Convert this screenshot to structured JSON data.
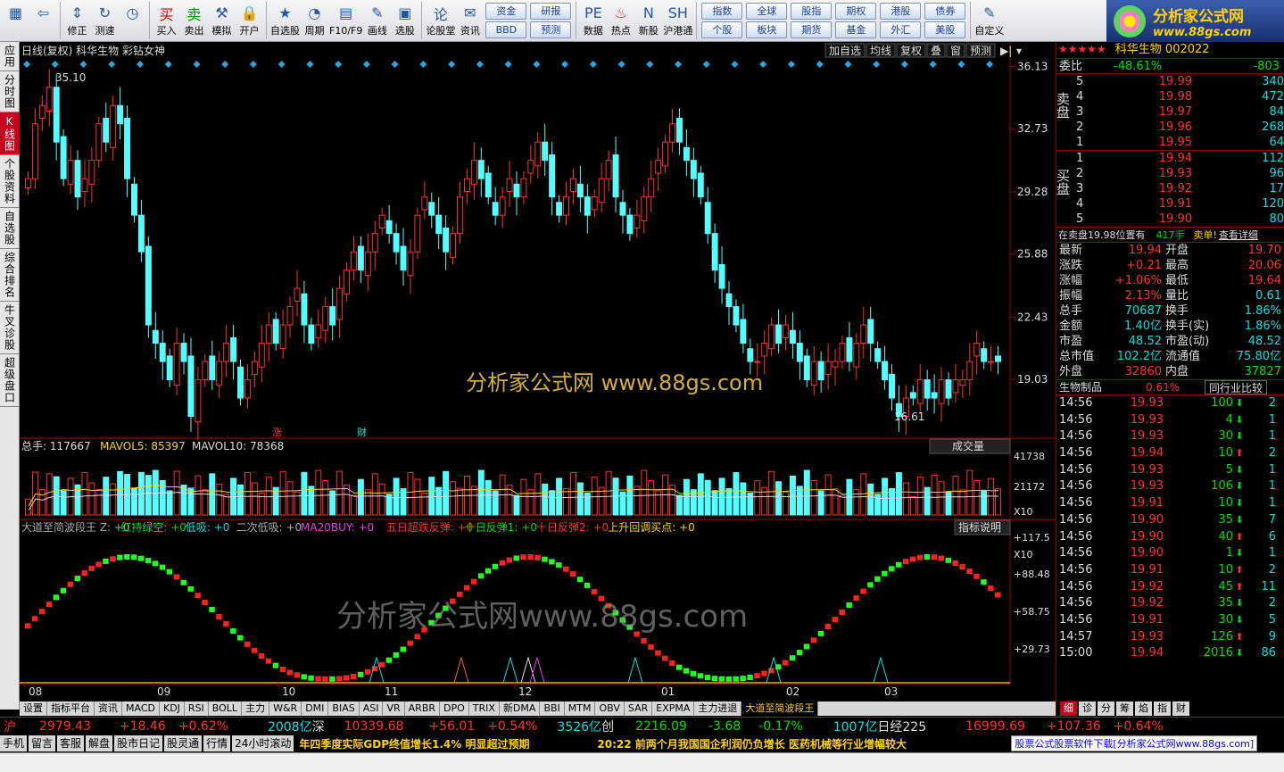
{
  "toolbar": {
    "items": [
      {
        "label": "",
        "icon": "grid-icon"
      },
      {
        "label": "",
        "icon": "back-arrow-icon"
      },
      {
        "label": "修正",
        "icon": "up-down-arrow-icon"
      },
      {
        "label": "测速",
        "icon": "refresh-icon"
      },
      {
        "label": "",
        "icon": "clock-icon"
      },
      {
        "label": "买入",
        "icon": "buy-icon"
      },
      {
        "label": "卖出",
        "icon": "sell-icon"
      },
      {
        "label": "模拟",
        "icon": "hammer-icon"
      },
      {
        "label": "开户",
        "icon": "lock-icon"
      },
      {
        "label": "自选股",
        "icon": "star-folder-icon"
      },
      {
        "label": "周期",
        "icon": "cycle-icon"
      },
      {
        "label": "F10/F9",
        "icon": "f10-icon"
      },
      {
        "label": "画线",
        "icon": "pen-icon"
      },
      {
        "label": "选股",
        "icon": "screen-icon"
      },
      {
        "label": "论股堂",
        "icon": "forum-icon"
      },
      {
        "label": "资讯",
        "icon": "news-icon"
      }
    ],
    "btn_group1": [
      "资金",
      "BBD"
    ],
    "btn_group2": [
      "研报",
      "预测"
    ],
    "items2": [
      {
        "label": "数据",
        "icon": "pe-icon"
      },
      {
        "label": "热点",
        "icon": "fire-icon"
      },
      {
        "label": "新股",
        "icon": "new-stock-icon"
      },
      {
        "label": "沪港通",
        "icon": "hk-icon"
      }
    ],
    "btn_group3": [
      [
        "指数",
        "个股"
      ],
      [
        "全球",
        "板块"
      ],
      [
        "股指",
        "期货"
      ],
      [
        "期权",
        "基金"
      ],
      [
        "港股",
        "外汇"
      ],
      [
        "债券",
        "美股"
      ]
    ],
    "custom": "自定义"
  },
  "logo": {
    "title": "分析家公式网",
    "url": "www.88gs.com"
  },
  "leftnav": [
    "应用",
    "分时图",
    "K线图",
    "个股资料",
    "自选股",
    "综合排名",
    "牛叉诊股",
    "超级盘口"
  ],
  "main": {
    "title": "日线(复权)  科华生物  彩钻女神",
    "toolbar_btns": [
      "加自选",
      "均线",
      "复权",
      "叠",
      "窗",
      "预测"
    ],
    "price_labels": [
      "36.13",
      "32.73",
      "29.28",
      "25.88",
      "22.43",
      "19.03"
    ],
    "high_marker": "35.10",
    "low_marker": "16.61",
    "bottom_marks": [
      "涨",
      "财"
    ],
    "watermark1": "分析家公式网 www.88gs.com",
    "watermark2": "分析家公式网www.88gs.com"
  },
  "volume": {
    "legend_total": "总手: 117667",
    "legend_ma5": "MAVOL5: 85397",
    "legend_ma10": "MAVOL10: 78368",
    "dropdown": "成交量",
    "labels": [
      "41738",
      "21172",
      "X10"
    ]
  },
  "indicator": {
    "legend": [
      {
        "text": "大道至简波段王 Z: +0",
        "color": "#aaaaaa"
      },
      {
        "text": "红持绿空: +0",
        "color": "#00e000"
      },
      {
        "text": "低吸: +0",
        "color": "#00e0e0"
      },
      {
        "text": "二次低吸: +0",
        "color": "#aaaaaa"
      },
      {
        "text": "MA20BUY: +0",
        "color": "#e040e0"
      },
      {
        "text": "五日超跌反弹: +0",
        "color": "#ff3030"
      },
      {
        "text": "十日反弹1: +0",
        "color": "#00e000"
      },
      {
        "text": "十日反弹2: +0",
        "color": "#ff3030"
      },
      {
        "text": "上升回调买点: +0",
        "color": "#ffd400"
      }
    ],
    "explain_btn": "指标说明",
    "labels": [
      "+117.5",
      "X10",
      "+88.48",
      "+58.75",
      "+29.73"
    ]
  },
  "xaxis": [
    "08",
    "09",
    "10",
    "11",
    "12",
    "01",
    "02",
    "03"
  ],
  "quote": {
    "header": "科华生物 002022",
    "webi_label": "委比",
    "webi_val": "-48.61%",
    "webi_diff": "-803",
    "sell_label": "卖盘",
    "sells": [
      {
        "n": "5",
        "p": "19.99",
        "v": "340"
      },
      {
        "n": "4",
        "p": "19.98",
        "v": "472"
      },
      {
        "n": "3",
        "p": "19.97",
        "v": "84"
      },
      {
        "n": "2",
        "p": "19.96",
        "v": "268"
      },
      {
        "n": "1",
        "p": "19.95",
        "v": "64"
      }
    ],
    "buy_label": "买盘",
    "buys": [
      {
        "n": "1",
        "p": "19.94",
        "v": "112"
      },
      {
        "n": "2",
        "p": "19.93",
        "v": "96"
      },
      {
        "n": "3",
        "p": "19.92",
        "v": "17"
      },
      {
        "n": "4",
        "p": "19.91",
        "v": "120"
      },
      {
        "n": "5",
        "p": "19.90",
        "v": "80"
      }
    ],
    "notice": "在卖盘19.98位置有",
    "notice_qty": "417手",
    "notice_type": "卖单!",
    "notice_link": "查看详细",
    "stats": [
      [
        "最新",
        "19.94",
        "开盘",
        "19.70"
      ],
      [
        "涨跌",
        "+0.21",
        "最高",
        "20.06"
      ],
      [
        "涨幅",
        "+1.06%",
        "最低",
        "19.64"
      ],
      [
        "振幅",
        "2.13%",
        "量比",
        "0.61"
      ],
      [
        "总手",
        "70687",
        "换手",
        "1.86%"
      ],
      [
        "金额",
        "1.40亿",
        "换手(实)",
        "1.86%"
      ],
      [
        "市盈",
        "48.52",
        "市盈(动)",
        "48.52"
      ],
      [
        "总市值",
        "102.2亿",
        "流通值",
        "75.80亿"
      ],
      [
        "外盘",
        "32860",
        "内盘",
        "37827"
      ]
    ],
    "industry": "生物制品",
    "industry_pct": "0.61%",
    "industry_btn": "同行业比较",
    "ticks": [
      [
        "14:56",
        "19.93",
        "100",
        "down",
        "2"
      ],
      [
        "14:56",
        "19.93",
        "4",
        "down",
        "1"
      ],
      [
        "14:56",
        "19.93",
        "30",
        "down",
        "1"
      ],
      [
        "14:56",
        "19.94",
        "10",
        "up",
        "2"
      ],
      [
        "14:56",
        "19.93",
        "5",
        "down",
        "1"
      ],
      [
        "14:56",
        "19.93",
        "106",
        "down",
        "1"
      ],
      [
        "14:56",
        "19.91",
        "10",
        "down",
        "1"
      ],
      [
        "14:56",
        "19.90",
        "35",
        "down",
        "7"
      ],
      [
        "14:56",
        "19.90",
        "40",
        "up",
        "6"
      ],
      [
        "14:56",
        "19.90",
        "1",
        "down",
        "1"
      ],
      [
        "14:56",
        "19.91",
        "10",
        "up",
        "2"
      ],
      [
        "14:56",
        "19.92",
        "45",
        "up",
        "11"
      ],
      [
        "14:56",
        "19.92",
        "35",
        "down",
        "2"
      ],
      [
        "14:56",
        "19.91",
        "30",
        "down",
        "5"
      ],
      [
        "14:57",
        "19.93",
        "126",
        "up",
        "9"
      ],
      [
        "15:00",
        "19.94",
        "2016",
        "down",
        "86"
      ]
    ]
  },
  "bottom_tabs": [
    "设置",
    "指标平台",
    "资讯",
    "MACD",
    "KDJ",
    "RSI",
    "BOLL",
    "主力",
    "W&R",
    "DMI",
    "BIAS",
    "ASI",
    "VR",
    "ARBR",
    "DPO",
    "TRIX",
    "新DMA",
    "BBI",
    "MTM",
    "OBV",
    "SAR",
    "EXPMA",
    "主力进退",
    "大道至简波段王"
  ],
  "right_tabs": [
    "细",
    "诊",
    "分",
    "筹",
    "焰",
    "指",
    "财"
  ],
  "status": {
    "sh_label": "沪",
    "sh_val": "2979.43",
    "sh_chg": "+18.46",
    "sh_pct": "+0.62%",
    "sh_amt": "2008亿",
    "sz_label": "深",
    "sz_val": "10339.68",
    "sz_chg": "+56.01",
    "sz_pct": "+0.54%",
    "sz_amt": "3526亿",
    "cy_label": "创",
    "cy_val": "2216.09",
    "cy_chg": "-3.68",
    "cy_pct": "-0.17%",
    "cy_amt": "1007亿",
    "nk_label": "日经225",
    "nk_val": "16999.69",
    "nk_chg": "+107.36",
    "nk_pct": "+0.64%"
  },
  "news": {
    "btns": [
      "手机",
      "留言",
      "客服",
      "解盘",
      "股市日记",
      "股灵通",
      "行情",
      "24小时滚动"
    ],
    "ticker1": "年四季度实际GDP终值增长1.4% 明显超过预期",
    "ticker2": "20:22 前两个月我国国企利润仍负增长 医药机械等行业增幅较大",
    "ad": "股票公式股票软件下载[分析家公式网www.88gs.com]"
  },
  "chart_data": {
    "type": "candlestick",
    "ylim": [
      16,
      36.5
    ],
    "x_labels": [
      "08",
      "09",
      "10",
      "11",
      "12",
      "01",
      "02",
      "03"
    ],
    "closes": [
      30,
      33,
      34,
      35,
      32,
      30,
      31,
      29,
      30,
      31,
      33,
      32,
      34,
      33,
      30,
      28,
      26,
      22,
      21,
      20,
      19,
      21,
      20,
      17,
      19,
      20,
      19,
      20,
      21,
      20,
      18,
      19,
      20,
      21,
      22,
      21,
      22,
      23,
      24,
      22,
      21,
      22,
      23,
      22,
      24,
      25,
      26,
      25,
      26,
      27,
      28,
      27,
      26,
      25,
      26,
      28,
      29,
      28,
      27,
      26,
      27,
      29,
      30,
      31,
      30,
      29,
      28,
      29,
      30,
      29,
      30,
      31,
      32,
      31,
      29,
      28,
      29,
      30,
      29,
      28,
      29,
      30,
      31,
      29,
      28,
      27,
      28,
      29,
      30,
      31,
      32,
      33,
      32,
      31,
      30,
      29,
      27,
      25,
      24,
      23,
      22,
      21,
      20,
      20,
      21,
      22,
      21,
      22,
      21,
      20,
      19,
      20,
      19,
      20,
      20,
      21,
      20,
      21,
      22,
      21,
      20,
      19,
      18,
      17,
      18,
      18,
      19,
      18,
      18,
      19,
      18,
      19,
      19,
      20,
      21,
      20,
      20,
      20
    ],
    "volume_ylim": [
      0,
      45000
    ],
    "indicator_ylim": [
      0,
      120
    ]
  }
}
